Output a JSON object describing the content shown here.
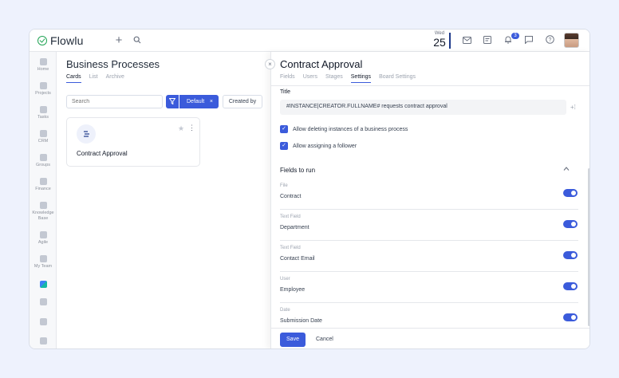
{
  "app": {
    "name": "Flowlu"
  },
  "topbar": {
    "date_day": "Wed",
    "date_num": "25",
    "notification_count": "3",
    "icons": [
      "plus-icon",
      "search-icon",
      "mail-icon",
      "tasks-icon",
      "bell-icon",
      "chat-icon",
      "help-icon"
    ]
  },
  "sidebar": {
    "items": [
      {
        "label": "Home",
        "icon": "home-icon"
      },
      {
        "label": "Projects",
        "icon": "projects-icon"
      },
      {
        "label": "Tasks",
        "icon": "tasks-icon"
      },
      {
        "label": "CRM",
        "icon": "crm-icon"
      },
      {
        "label": "Groups",
        "icon": "groups-icon"
      },
      {
        "label": "Finance",
        "icon": "finance-icon"
      },
      {
        "label": "Knowledge Base",
        "icon": "knowledge-icon"
      },
      {
        "label": "Agile",
        "icon": "agile-icon"
      },
      {
        "label": "My Team",
        "icon": "team-icon"
      },
      {
        "label": "",
        "icon": "business-processes-icon"
      },
      {
        "label": "",
        "icon": "apps-icon"
      },
      {
        "label": "",
        "icon": "settings-icon"
      },
      {
        "label": "",
        "icon": "more-icon"
      }
    ]
  },
  "main": {
    "title": "Business Processes",
    "tabs": [
      {
        "label": "Cards",
        "active": true
      },
      {
        "label": "List",
        "active": false
      },
      {
        "label": "Archive",
        "active": false
      }
    ],
    "search_placeholder": "Search",
    "filter_label": "Default",
    "filter_clear": "×",
    "created_by_label": "Created by",
    "card": {
      "title": "Contract Approval",
      "icon": "process-icon"
    }
  },
  "panel": {
    "title": "Contract Approval",
    "tabs": [
      {
        "label": "Fields",
        "active": false
      },
      {
        "label": "Users",
        "active": false
      },
      {
        "label": "Stages",
        "active": false
      },
      {
        "label": "Settings",
        "active": true
      },
      {
        "label": "Board Settings",
        "active": false
      }
    ],
    "title_label": "Title",
    "title_value": "#INSTANCE|CREATOR.FULLNAME# requests contract approval",
    "checkboxes": [
      {
        "label": "Allow deleting instances of a business process",
        "checked": true
      },
      {
        "label": "Allow assigning a follower",
        "checked": true
      }
    ],
    "fields_section_title": "Fields to run",
    "fields": [
      {
        "type": "File",
        "name": "Contract",
        "enabled": true
      },
      {
        "type": "Text Field",
        "name": "Department",
        "enabled": true
      },
      {
        "type": "Text Field",
        "name": "Contact Email",
        "enabled": true
      },
      {
        "type": "User",
        "name": "Employee",
        "enabled": true
      },
      {
        "type": "Date",
        "name": "Submission Date",
        "enabled": true
      }
    ],
    "save_label": "Save",
    "cancel_label": "Cancel"
  },
  "colors": {
    "accent": "#3b5bdb",
    "brand_green": "#22a455"
  }
}
